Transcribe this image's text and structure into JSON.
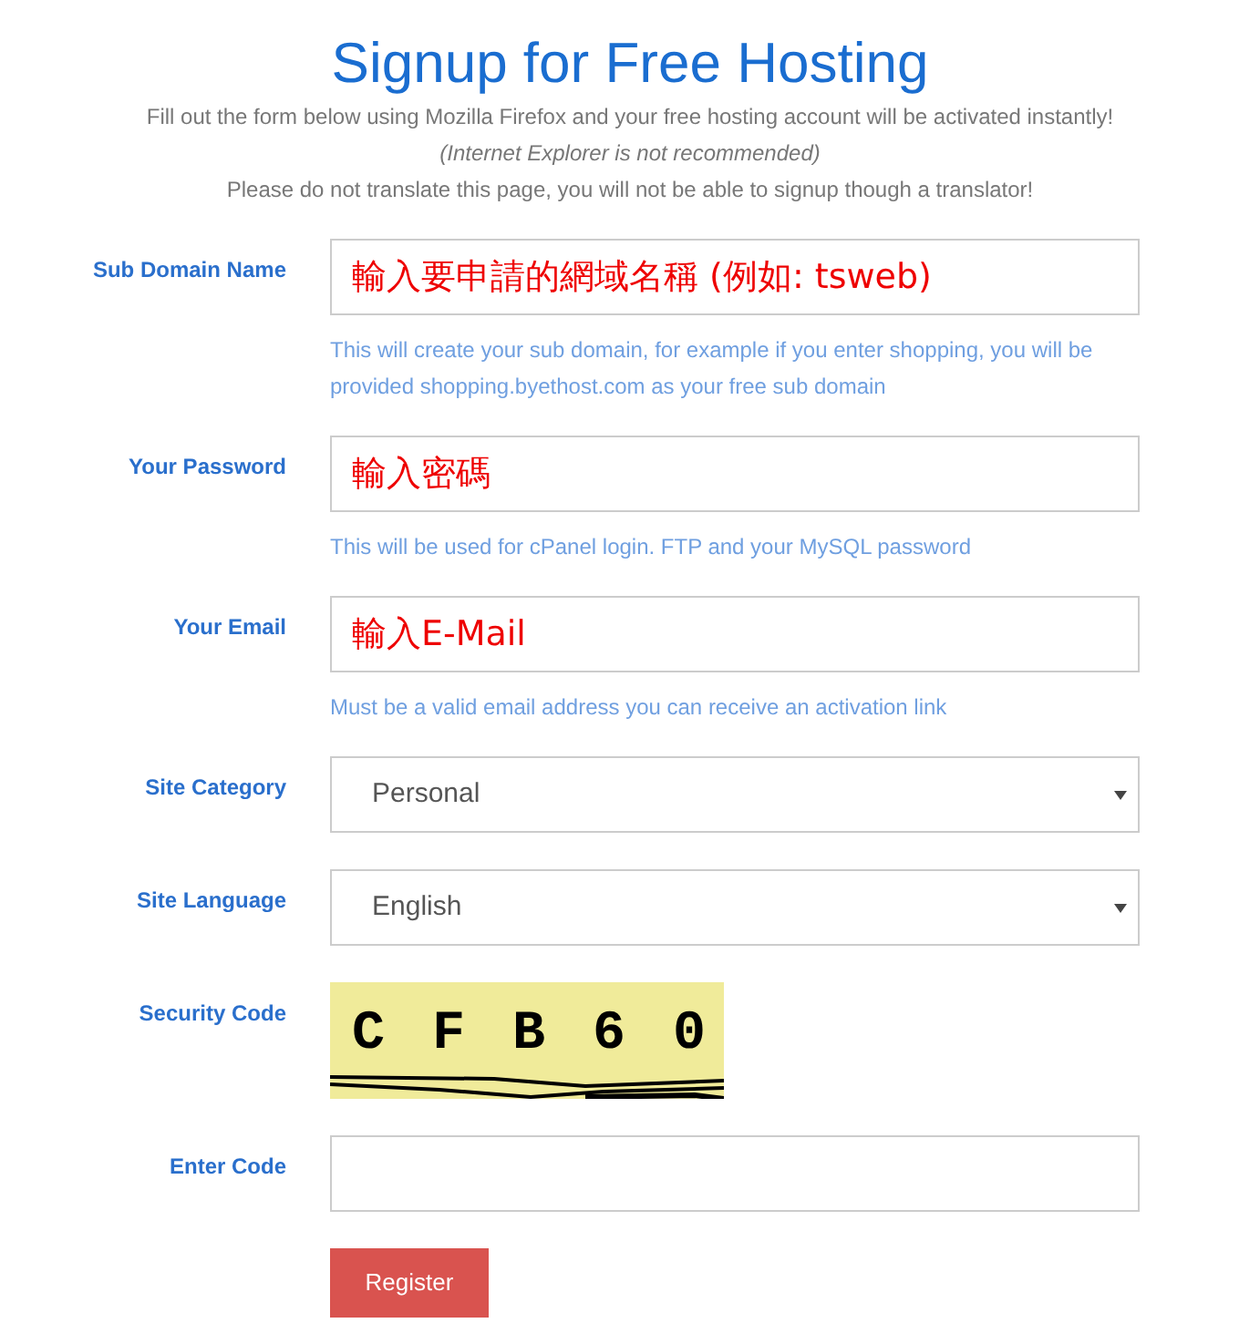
{
  "title": "Signup for Free Hosting",
  "intro": [
    {
      "text": "Fill out the form below using Mozilla Firefox and your free hosting account will be activated instantly!",
      "italic": false
    },
    {
      "text": "(Internet Explorer is not recommended)",
      "italic": true
    },
    {
      "text": "Please do not translate this page, you will not be able to signup though a translator!",
      "italic": false
    }
  ],
  "fields": [
    {
      "kind": "text",
      "label": "Sub Domain Name",
      "value": "輸入要申請的網域名稱 (例如: tsweb)",
      "hint": "This will create your sub domain, for example if you enter shopping, you will be provided shopping.byethost.com as your free sub domain"
    },
    {
      "kind": "text",
      "label": "Your Password",
      "value": "輸入密碼",
      "hint": "This will be used for cPanel login. FTP and your MySQL password"
    },
    {
      "kind": "text",
      "label": "Your Email",
      "value": "輸入E-Mail",
      "hint": "Must be a valid email address you can receive an activation link"
    },
    {
      "kind": "select",
      "label": "Site Category",
      "value": "Personal"
    },
    {
      "kind": "select",
      "label": "Site Language",
      "value": "English"
    },
    {
      "kind": "captcha",
      "label": "Security Code",
      "value": "C F B 6 0"
    },
    {
      "kind": "text",
      "label": "Enter Code"
    }
  ],
  "submit": "Register"
}
